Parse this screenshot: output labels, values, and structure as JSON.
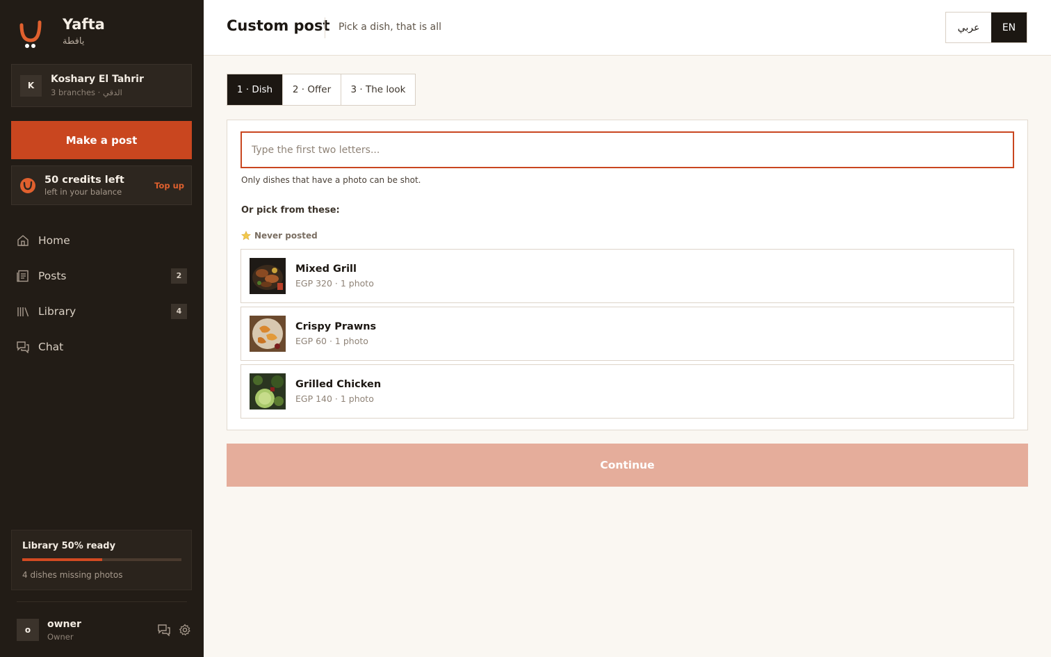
{
  "brand": {
    "name": "Yafta",
    "arabic_name": "يافطة",
    "logo_icon": "smile-logo-icon",
    "accent": "#d24a22"
  },
  "org": {
    "avatar_letter": "K",
    "name": "Koshary El Tahrir",
    "subtitle": "3 branches · الدقي"
  },
  "sidebar": {
    "make_post_label": "Make a post",
    "credits": {
      "title": "50 credits left",
      "subtitle": "left in your balance",
      "top_up_label": "Top up"
    },
    "nav": [
      {
        "label": "Home",
        "icon": "home-icon",
        "badge": ""
      },
      {
        "label": "Posts",
        "icon": "posts-icon",
        "badge": "2"
      },
      {
        "label": "Library",
        "icon": "library-icon",
        "badge": "4"
      },
      {
        "label": "Chat",
        "icon": "chat-icon",
        "badge": ""
      }
    ],
    "library_status": {
      "title": "Library 50% ready",
      "progress": 0.5,
      "subtitle": "4 dishes missing photos"
    },
    "user": {
      "avatar_letter": "o",
      "name": "owner",
      "role": "Owner"
    }
  },
  "header": {
    "title": "Custom post",
    "subtitle": "Pick a dish, that is all",
    "lang_options": [
      "عربي",
      "EN"
    ],
    "active_lang": "EN"
  },
  "steps": [
    {
      "label": "1 · Dish",
      "active": true
    },
    {
      "label": "2 · Offer",
      "active": false
    },
    {
      "label": "3 · The look",
      "active": false
    }
  ],
  "dish_picker": {
    "search_placeholder": "Type the first two letters...",
    "search_value": "",
    "hint": "Only dishes that have a photo can be shot.",
    "pick_label": "Or pick from these:",
    "group_label": "Never posted",
    "group_icon": "star-icon",
    "dishes": [
      {
        "name": "Mixed Grill",
        "meta": "EGP 320 · 1 photo"
      },
      {
        "name": "Crispy Prawns",
        "meta": "EGP 60 · 1 photo"
      },
      {
        "name": "Grilled Chicken",
        "meta": "EGP 140 · 1 photo"
      }
    ]
  },
  "continue_label": "Continue"
}
